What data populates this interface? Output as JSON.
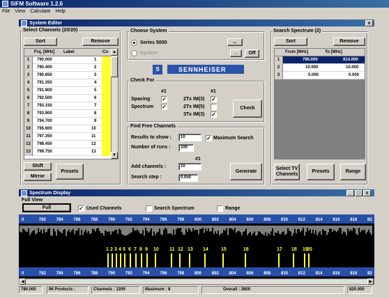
{
  "app": {
    "title": "SIFM Software 1.2.6",
    "menu": [
      "File",
      "View",
      "Calculate",
      "Help"
    ]
  },
  "editor": {
    "title": "System Editor",
    "close": "x",
    "channels": {
      "label": "Select Channels (20/20)",
      "sort": "Sort",
      "remove": "Remove",
      "cols": [
        "Frq. [MHz]",
        "Label",
        "Co"
      ],
      "rows": [
        {
          "n": "1",
          "f": "790.000",
          "l": "1"
        },
        {
          "n": "2",
          "f": "790.400",
          "l": "2"
        },
        {
          "n": "3",
          "f": "790.850",
          "l": "3"
        },
        {
          "n": "4",
          "f": "791.350",
          "l": "4"
        },
        {
          "n": "5",
          "f": "791.900",
          "l": "5"
        },
        {
          "n": "6",
          "f": "792.500",
          "l": "6"
        },
        {
          "n": "7",
          "f": "793.150",
          "l": "7"
        },
        {
          "n": "8",
          "f": "793.900",
          "l": "8"
        },
        {
          "n": "9",
          "f": "794.700",
          "l": "9"
        },
        {
          "n": "10",
          "f": "795.600",
          "l": "10"
        },
        {
          "n": "11",
          "f": "797.350",
          "l": "11"
        },
        {
          "n": "12",
          "f": "798.450",
          "l": "12"
        },
        {
          "n": "13",
          "f": "799.750",
          "l": "13"
        }
      ],
      "shift": "Shift",
      "mirror": "Mirror",
      "presets": "Presets"
    },
    "system": {
      "label": "Choose System",
      "series": "Series 5000",
      "system_lbl": "System :",
      "browse": "...",
      "off": "Off",
      "brand": "SENNHEISER"
    },
    "check": {
      "label": "Check For",
      "num1": "#1",
      "num2": "#1",
      "spacing": "Spacing",
      "spectrum": "Spectrum",
      "im3a": "2Tx IM(3)",
      "im3b": "2Tx IM(5)",
      "im3c": "3Tx IM(3)",
      "check_btn": "Check"
    },
    "free": {
      "label": "Find Free Channels",
      "results_lbl": "Results to show :",
      "results_val": "10",
      "runs_lbl": "Number of runs :",
      "runs_val": "100",
      "max": "Maximum Search",
      "num": "#1",
      "add_lbl": "Add channels :",
      "add_val": "10",
      "step_lbl": "Search step :",
      "step_val": "0.050",
      "generate": "Generate"
    },
    "search": {
      "label": "Search Spectrum (2)",
      "sort": "Sort",
      "remove": "Remove",
      "cols": [
        "From [MHz]",
        "To [MHz]"
      ],
      "rows": [
        {
          "n": "1",
          "from": "790.000",
          "to": "814.000"
        },
        {
          "n": "2",
          "from": "10.000",
          "to": "10.000"
        },
        {
          "n": "3",
          "from": "0.000",
          "to": "0.000"
        }
      ],
      "select_tv": "Select TV Channels",
      "presets": "Presets",
      "range": "Range"
    }
  },
  "spectrum": {
    "title": "Spectrum Display",
    "controls": [
      "_",
      "□",
      "x"
    ],
    "full_view": "Full View",
    "full": "Full",
    "used": "Used Channels",
    "search": "Search Spectrum",
    "range": "Range",
    "ticks": [
      "0",
      "782",
      "784",
      "786",
      "788",
      "790",
      "792",
      "794",
      "796",
      "798",
      "800",
      "802",
      "804",
      "806",
      "808",
      "810",
      "812",
      "814",
      "816",
      "818",
      "82"
    ],
    "chan_labels": [
      "1",
      "2",
      "3",
      "4",
      "5",
      "6",
      "7",
      "8",
      "9",
      "10",
      "11",
      "12",
      "13",
      "14",
      "15",
      "16",
      "17",
      "18",
      "19",
      "20"
    ],
    "status": {
      "left": "780.000",
      "im": "IM Products :",
      "channels": "Channels : 1209",
      "maximum": "Maximum : 8",
      "overall": "Overall : 3800",
      "right": "820.000"
    },
    "colors": {
      "bg": "#000000",
      "axis": "#2850a8",
      "chan": "#ffff30",
      "noise": "#ffffff"
    }
  }
}
